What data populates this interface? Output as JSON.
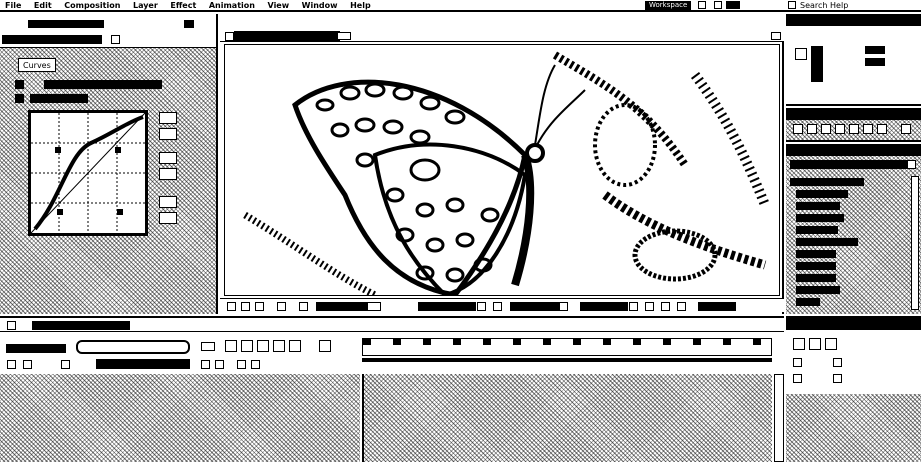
{
  "menubar": {
    "items": [
      "File",
      "Edit",
      "Composition",
      "Layer",
      "Effect",
      "Animation",
      "View",
      "Window",
      "Help"
    ],
    "workspace_label": "Workspace",
    "search_label": "Search Help"
  },
  "effect_controls": {
    "tab_label": "Curves"
  },
  "colors": {
    "background": "#ffffff",
    "ink": "#000000"
  }
}
